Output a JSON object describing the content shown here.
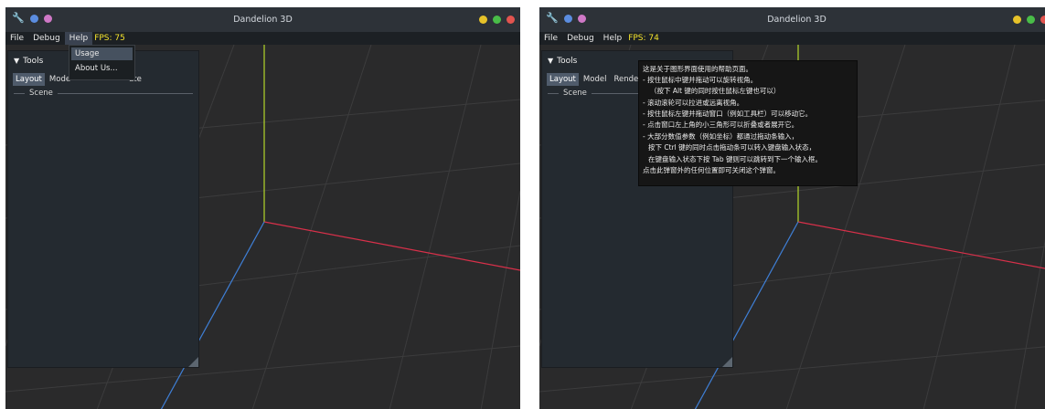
{
  "windows": [
    {
      "title": "Dandelion 3D",
      "menu": {
        "file": "File",
        "debug": "Debug",
        "help": "Help",
        "fps": "FPS: 75"
      },
      "tools": {
        "header": "Tools",
        "tabs": [
          "Layout",
          "Mode",
          "ate"
        ],
        "scene": "Scene"
      },
      "help_menu": {
        "items": [
          "Usage",
          "About Us..."
        ]
      }
    },
    {
      "title": "Dandelion 3D",
      "menu": {
        "file": "File",
        "debug": "Debug",
        "help": "Help",
        "fps": "FPS: 74"
      },
      "tools": {
        "header": "Tools",
        "tabs": [
          "Layout",
          "Model",
          "Rende"
        ],
        "scene": "Scene"
      },
      "help_popup": {
        "lines": [
          "这是关于图形界面使用的帮助页面。",
          "- 按住鼠标中键并拖动可以旋转视角。",
          "（按下 Alt 键的同时按住鼠标左键也可以）",
          "- 滚动滚轮可以拉进或远离视角。",
          "- 按住鼠标左键并拖动窗口（例如工具栏）可以移动它。",
          "- 点击窗口左上角的小三角形可以折叠或者展开它。",
          "- 大部分数值参数（例如坐标）都通过拖动条输入，",
          "按下 Ctrl 键的同时点击拖动条可以转入键盘输入状态，",
          "在键盘输入状态下按 Tab 键则可以跳转到下一个输入框。",
          "点击此弹窗外的任何位置即可关闭这个弹窗。"
        ]
      }
    }
  ],
  "colors": {
    "title_bar": "#2d3238",
    "menu_bar": "#1c2024",
    "viewport": "#2a2a2b",
    "panel": "#242a30",
    "fps": "#f5e42c",
    "axis_x": "#d9304a",
    "axis_y": "#b4d82a",
    "axis_z": "#3f7fd6",
    "dot_red": "#e2544f",
    "dot_yellow": "#e6c229",
    "dot_green": "#49bd48",
    "dot_blue": "#5b8de0",
    "dot_pink": "#cf78c6"
  }
}
